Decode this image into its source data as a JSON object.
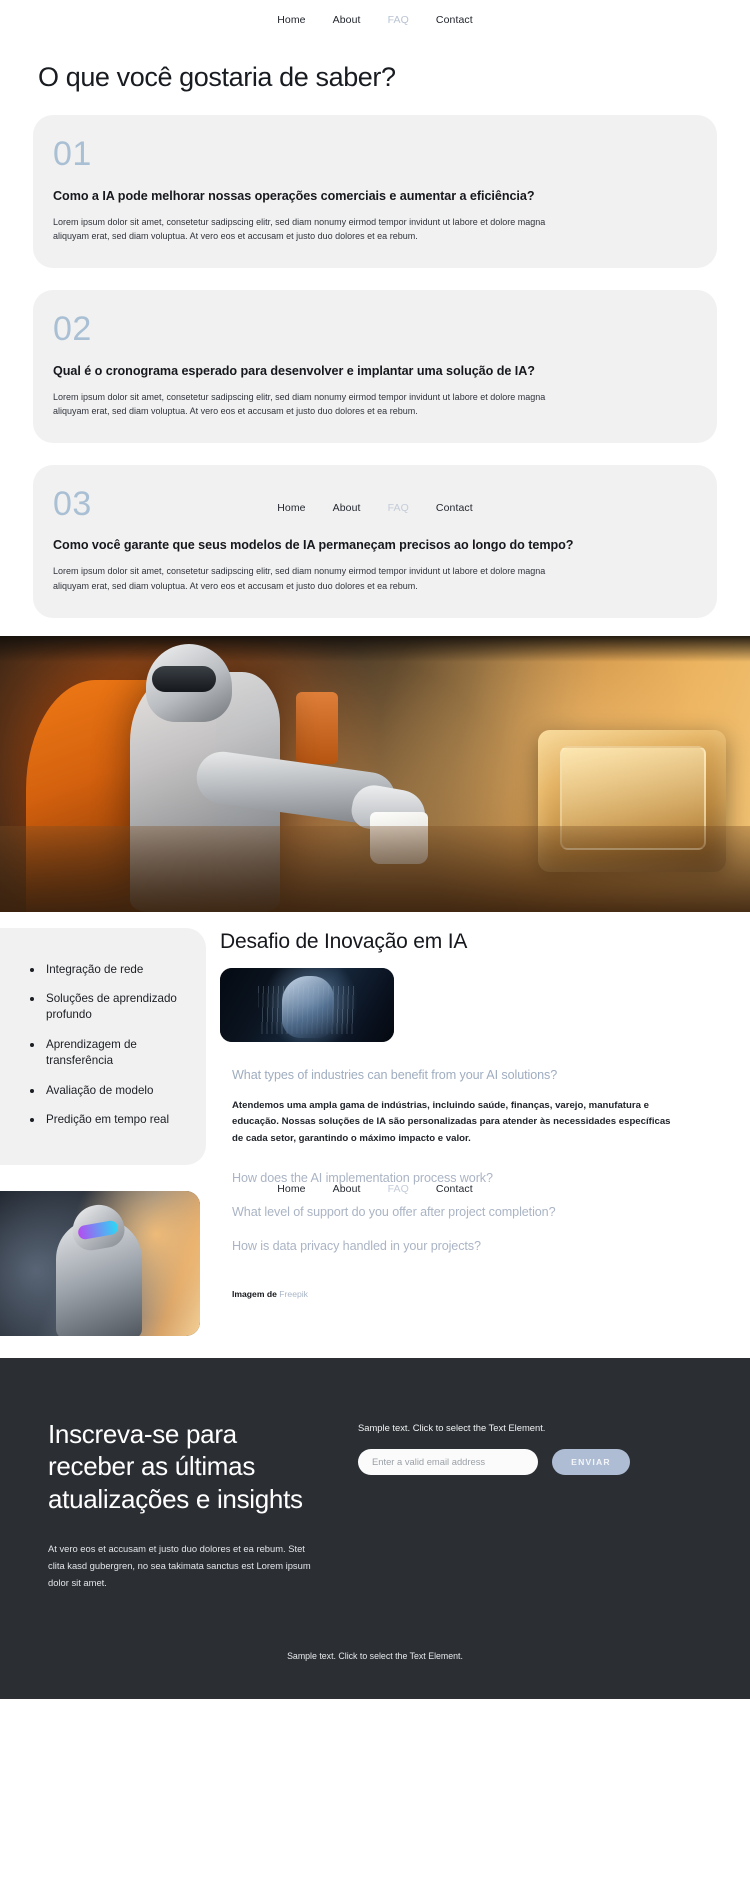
{
  "nav": {
    "items": [
      {
        "label": "Home",
        "active": false
      },
      {
        "label": "About",
        "active": false
      },
      {
        "label": "FAQ",
        "active": true
      },
      {
        "label": "Contact",
        "active": false
      }
    ]
  },
  "faq_section": {
    "title": "O que você gostaria de saber?",
    "cards": [
      {
        "number": "01",
        "question": "Como a IA pode melhorar nossas operações comerciais e aumentar a eficiência?",
        "answer": "Lorem ipsum dolor sit amet, consetetur sadipscing elitr, sed diam nonumy eirmod tempor invidunt ut labore et dolore magna aliquyam erat, sed diam voluptua. At vero eos et accusam et justo duo dolores et ea rebum."
      },
      {
        "number": "02",
        "question": "Qual é o cronograma esperado para desenvolver e implantar uma solução de IA?",
        "answer": "Lorem ipsum dolor sit amet, consetetur sadipscing elitr, sed diam nonumy eirmod tempor invidunt ut labore et dolore magna aliquyam erat, sed diam voluptua. At vero eos et accusam et justo duo dolores et ea rebum."
      },
      {
        "number": "03",
        "question": "Como você garante que seus modelos de IA permaneçam precisos ao longo do tempo?",
        "answer": "Lorem ipsum dolor sit amet, consetetur sadipscing elitr, sed diam nonumy eirmod tempor invidunt ut labore et dolore magna aliquyam erat, sed diam voluptua. At vero eos et accusam et justo duo dolores et ea rebum."
      }
    ]
  },
  "features": {
    "items": [
      "Integração de rede",
      "Soluções de aprendizado profundo",
      "Aprendizagem de transferência",
      "Avaliação de modelo",
      "Predição em tempo real"
    ]
  },
  "innovation": {
    "title": "Desafio de Inovação em IA",
    "accordion": [
      {
        "question": "What types of industries can benefit from your AI solutions?",
        "answer": "Atendemos uma ampla gama de indústrias, incluindo saúde, finanças, varejo, manufatura e educação. Nossas soluções de IA são personalizadas para atender às necessidades específicas de cada setor, garantindo o máximo impacto e valor.",
        "open": true
      },
      {
        "question": "How does the AI implementation process work?",
        "answer": "",
        "open": false
      },
      {
        "question": "What level of support do you offer after project completion?",
        "answer": "",
        "open": false
      },
      {
        "question": "How is data privacy handled in your projects?",
        "answer": "",
        "open": false
      }
    ],
    "credit_prefix": "Imagem de",
    "credit_link": "Freepik"
  },
  "cta": {
    "heading": "Inscreva-se para receber as últimas atualizações e insights",
    "paragraph": "At vero eos et accusam et justo duo dolores et ea rebum. Stet clita kasd gubergren, no sea takimata sanctus est Lorem ipsum dolor sit amet.",
    "sample_text": "Sample text. Click to select the Text Element.",
    "email_placeholder": "Enter a valid email address",
    "email_value": "",
    "submit_label": "ENVIAR",
    "footer_text": "Sample text. Click to select the Text Element."
  },
  "colors": {
    "accent_number": "#a9bfd4",
    "muted_nav": "#b9c3d2",
    "card_bg": "#f1f1f1",
    "dark_bg": "#2b2f34",
    "button": "#aebdd4"
  }
}
